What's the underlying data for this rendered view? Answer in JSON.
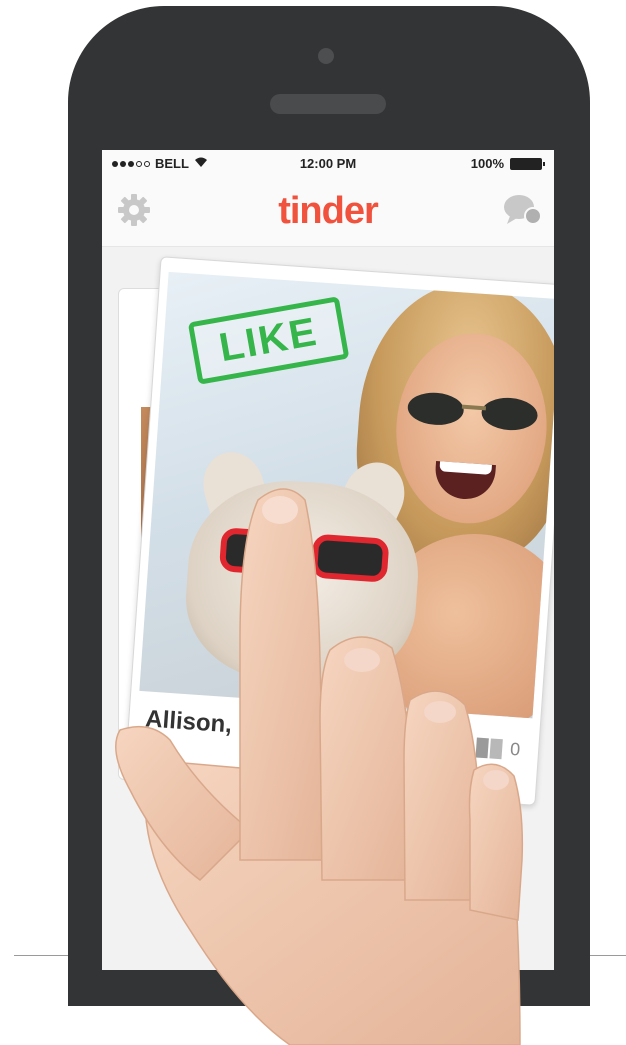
{
  "status_bar": {
    "carrier": "BELL",
    "time": "12:00 PM",
    "battery": "100%"
  },
  "nav": {
    "logo": "tinder",
    "settings_icon": "gear-icon",
    "chat_icon": "chat-icon"
  },
  "card": {
    "stamp": "LIKE",
    "name": "Allison,",
    "count": "0"
  },
  "colors": {
    "brand": "#f0523d",
    "like": "#36b54a",
    "phone": "#333435"
  }
}
